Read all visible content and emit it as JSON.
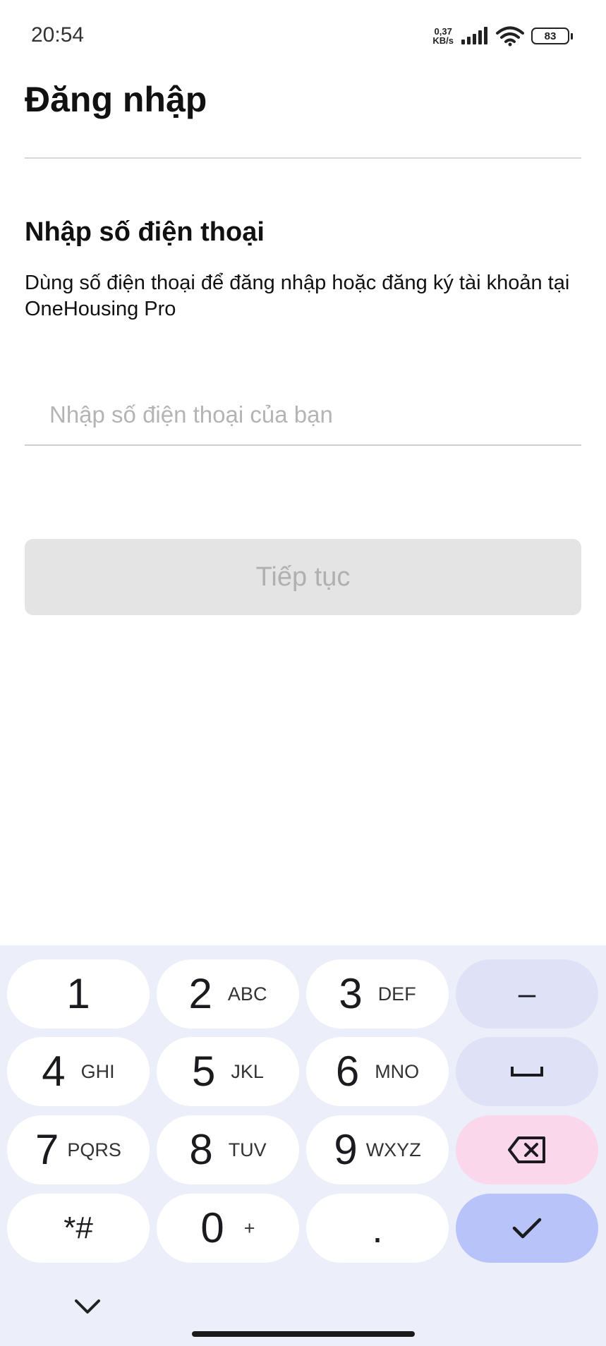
{
  "status_bar": {
    "time": "20:54",
    "net_speed_value": "0,37",
    "net_speed_unit": "KB/s",
    "battery": "83",
    "icons": [
      "signal-icon",
      "wifi-icon",
      "battery-icon"
    ]
  },
  "header": {
    "title": "Đăng nhập"
  },
  "form": {
    "section_title": "Nhập số điện thoại",
    "description": "Dùng số điện thoại để đăng nhập hoặc đăng ký tài khoản tại OneHousing Pro",
    "phone_placeholder": "Nhập số điện thoại của bạn",
    "phone_value": "",
    "continue_label": "Tiếp tục"
  },
  "keypad": {
    "keys": [
      {
        "digit": "1",
        "letters": ""
      },
      {
        "digit": "2",
        "letters": "ABC"
      },
      {
        "digit": "3",
        "letters": "DEF"
      },
      {
        "digit": "4",
        "letters": "GHI"
      },
      {
        "digit": "5",
        "letters": "JKL"
      },
      {
        "digit": "6",
        "letters": "MNO"
      },
      {
        "digit": "7",
        "letters": "PQRS"
      },
      {
        "digit": "8",
        "letters": "TUV"
      },
      {
        "digit": "9",
        "letters": "WXYZ"
      },
      {
        "digit": "*#",
        "letters": ""
      },
      {
        "digit": "0",
        "letters": "+"
      },
      {
        "digit": ".",
        "letters": ""
      }
    ],
    "dash_label": "–",
    "icons": [
      "space-icon",
      "backspace-icon",
      "check-icon",
      "chevron-down-icon"
    ],
    "colors": {
      "background": "#eceef9",
      "function_key": "#dfe1f6",
      "delete_key": "#fbd7ec",
      "done_key": "#b8c3f9"
    }
  }
}
